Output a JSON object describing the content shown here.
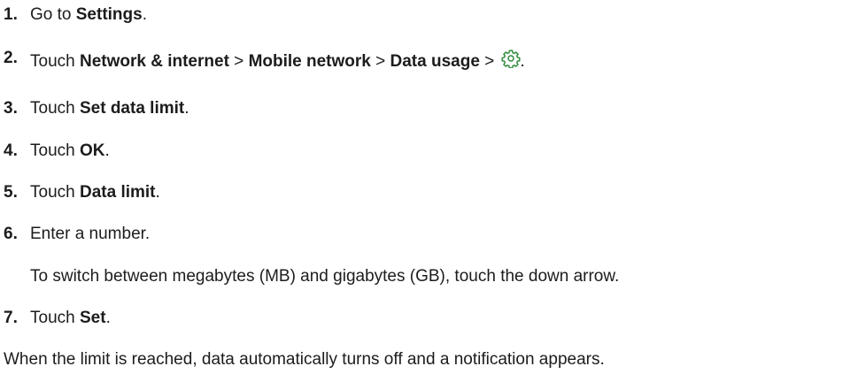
{
  "steps": [
    {
      "num": "1.",
      "pre": "Go to ",
      "bold": "Settings",
      "post": "."
    },
    {
      "num": "2.",
      "pre": "Touch ",
      "path": [
        "Network & internet",
        "Mobile network",
        "Data usage"
      ],
      "sep": " > ",
      "icon": "gear-icon",
      "post": "."
    },
    {
      "num": "3.",
      "pre": "Touch ",
      "bold": "Set data limit",
      "post": "."
    },
    {
      "num": "4.",
      "pre": "Touch ",
      "bold": "OK",
      "post": "."
    },
    {
      "num": "5.",
      "pre": "Touch ",
      "bold": "Data limit",
      "post": "."
    },
    {
      "num": "6.",
      "text": "Enter a number.",
      "sub": "To switch between megabytes (MB) and gigabytes (GB), touch the down arrow."
    },
    {
      "num": "7.",
      "pre": "Touch ",
      "bold": "Set",
      "post": "."
    }
  ],
  "closing": "When the limit is reached, data automatically turns off and a notification appears.",
  "colors": {
    "icon": "#2e8b3a",
    "text": "#1c1c1c"
  }
}
